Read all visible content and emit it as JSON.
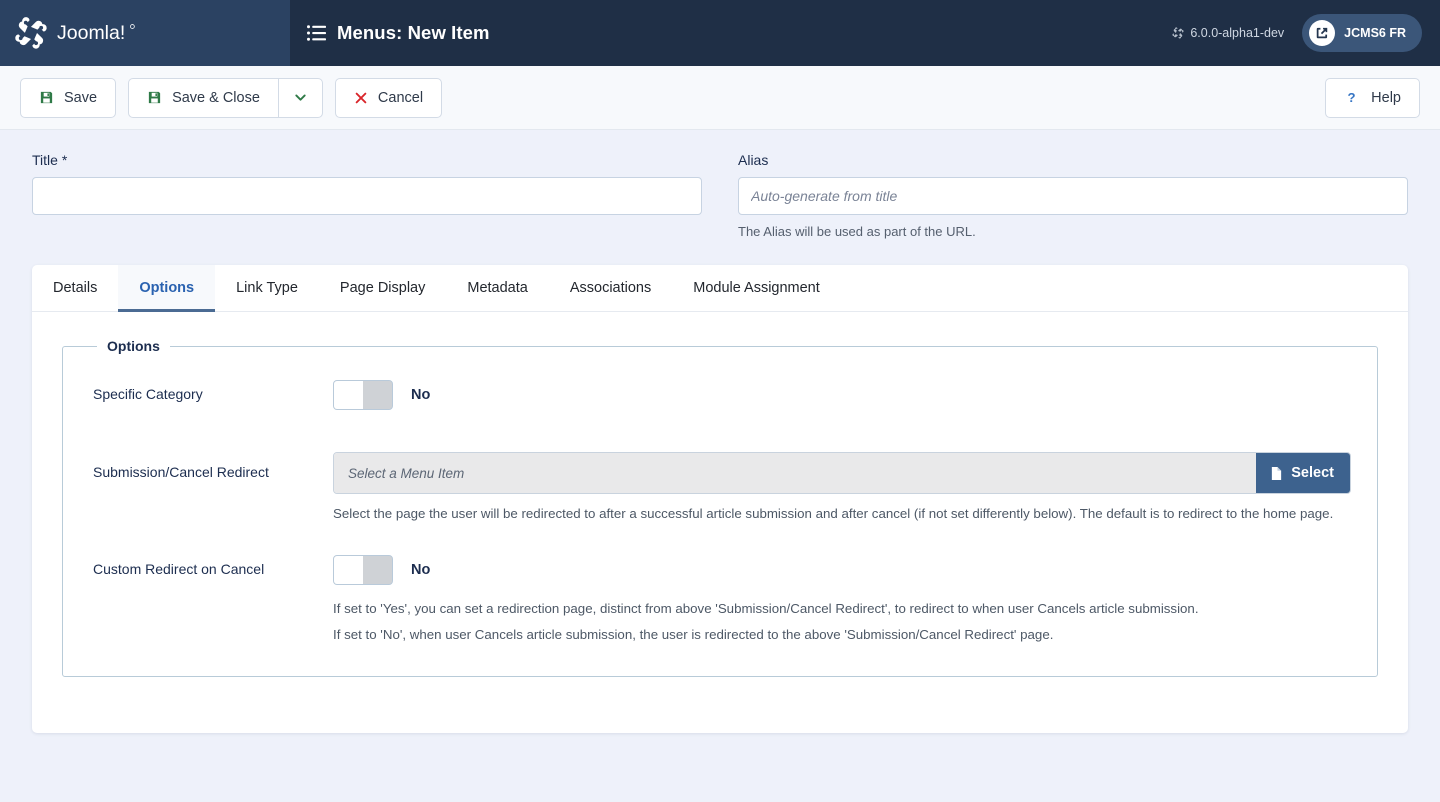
{
  "header": {
    "brand_name": "Joomla!",
    "brand_icon": "joomla-logo-icon",
    "title": "Menus: New Item",
    "title_icon": "list-icon",
    "version": "6.0.0-alpha1-dev",
    "version_icon": "joomla-mark-icon",
    "site_link_label": "JCMS6 FR",
    "site_link_icon": "external-link-icon",
    "colors": {
      "brand_bg": "#2b4262",
      "header_bg": "#1f2f46",
      "pill_bg": "#3b5679",
      "accent": "#2a62b0",
      "select_btn": "#3d628e"
    }
  },
  "toolbar": {
    "save_label": "Save",
    "save_icon": "save-icon",
    "save_close_label": "Save & Close",
    "save_close_icon": "save-icon",
    "save_dropdown_icon": "chevron-down-icon",
    "cancel_label": "Cancel",
    "cancel_icon": "close-x-icon",
    "help_label": "Help",
    "help_icon": "question-mark-icon"
  },
  "form_top": {
    "title_label": "Title *",
    "title_value": "",
    "title_placeholder": "",
    "alias_label": "Alias",
    "alias_value": "",
    "alias_placeholder": "Auto-generate from title",
    "alias_hint": "The Alias will be used as part of the URL."
  },
  "tabs": [
    {
      "label": "Details",
      "active": false
    },
    {
      "label": "Options",
      "active": true
    },
    {
      "label": "Link Type",
      "active": false
    },
    {
      "label": "Page Display",
      "active": false
    },
    {
      "label": "Metadata",
      "active": false
    },
    {
      "label": "Associations",
      "active": false
    },
    {
      "label": "Module Assignment",
      "active": false
    }
  ],
  "options_panel": {
    "legend": "Options",
    "fields": {
      "specific_category": {
        "label": "Specific Category",
        "state": "No"
      },
      "submission_cancel_redirect": {
        "label": "Submission/Cancel Redirect",
        "value": "",
        "placeholder": "Select a Menu Item",
        "select_button": "Select",
        "select_button_icon": "file-icon",
        "description": "Select the page the user will be redirected to after a successful article submission and after cancel (if not set differently below). The default is to redirect to the home page."
      },
      "custom_redirect_on_cancel": {
        "label": "Custom Redirect on Cancel",
        "state": "No",
        "description_line1": "If set to 'Yes', you can set a redirection page, distinct from above 'Submission/Cancel Redirect', to redirect to when user Cancels article submission.",
        "description_line2": "If set to 'No', when user Cancels article submission, the user is redirected to the above 'Submission/Cancel Redirect' page."
      }
    }
  }
}
